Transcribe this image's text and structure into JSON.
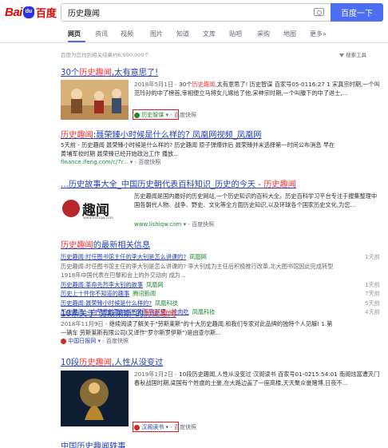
{
  "header": {
    "logo_bai": "Bai",
    "logo_paw": "du",
    "logo_cn": "百度",
    "search_value": "历史趣闻",
    "search_button": "百度一下"
  },
  "tabs": [
    "网页",
    "资讯",
    "视频",
    "图片",
    "知道",
    "文库",
    "贴吧",
    "采购",
    "地图",
    "更多»"
  ],
  "result_count": "百度为您找到相关结果约6,690,000个",
  "tools": "搜索工具",
  "results": {
    "r1": {
      "title_a": "30个",
      "title_em": "历史趣闻",
      "title_b": ",太有意思了!",
      "date": "2018年5月1日 - ",
      "abs_a": "30个",
      "abs_em1": "历史趣闻",
      "abs_b": ",太有意思了! 历史智谋 百家号05-0116:27 1 宋真宗时期,一个叫范玲孙的中了榜首,宰相便立马将女儿嫁给了他,宋神宗时期,一个叫滕下的中了进士,...",
      "source": "历史智谋",
      "snapshot": "百度快照"
    },
    "r2": {
      "title_em": "历史趣闻",
      "title_b": ":聂荣臻小时候是什么样的? 凤凰网视频_凤凰网",
      "abs": "5天前 - 历史趣闻 聂荣臻小时候是什么样的? 历史趣闻 原子弹爆炸后 聂荣臻并未选择第一时间公布消息 早在黄埔军校时期 聂荣臻已经开始政治工作 播放...",
      "url": "finance.ifeng.com/c/7r...",
      "snapshot": "百度快照"
    },
    "r3": {
      "title_a": "...历史故事大全_中国历史朝代表百科知识_历史的今天 - ",
      "title_em": "历史趣闻",
      "abs": "历史趣闻是国内最好的历史网站,一个历史知识的百科大全。历史百科学习平台专注于搜集整理中国各朝代人物、战争、野史、文化等全方面历史知识,以及环球各个国家历史文化,为您...",
      "logo_text": "趣闻",
      "logo_sub": "www.lishiqw.com",
      "url": "www.lishiqw.com",
      "snapshot": "百度快照"
    },
    "news": {
      "title_em": "历史趣闻",
      "title_b": "的最新相关信息",
      "rows": [
        {
          "title": "历史趣闻:时任图书馆主任的李大钊是怎么讲课的?",
          "source": "凤凰网",
          "date": "1天前"
        },
        {
          "title": "历史趣闻:时任图书馆主任的李大钊是怎么讲课的? 李大钊成为主任后积极推行改革,北大图书馆因此完成转型 1918年中国代表在巴黎和会上的外交动向 成为...",
          "source": "",
          "date": ""
        },
        {
          "title": "历史趣闻:革命先烈李大钊的故事",
          "source": "凤凰网",
          "date": "1天前"
        },
        {
          "title": "历史上十件你不知道的趣事",
          "source": "腾讯新闻",
          "date": "7天前"
        },
        {
          "title": "历史趣闻:聂荣臻小时候是什么样的?",
          "source": "凤凰科技",
          "date": "5天前"
        },
        {
          "title": "历史趣闻:一向节俭的影响依旧到陈赓那里一抢肉吃",
          "source": "凤凰科技",
          "date": "4天前"
        }
      ]
    },
    "r5": {
      "title_a": "10条关于\"劳斯莱斯\"的",
      "title_em": "历史趣闻",
      "date": "2018年11月9日 - ",
      "abs": "继续阅读了解关于\"劳斯莱斯\"的十大历史趣闻,和我们专家对此品牌的独特个人见解! 1.第一辆车 劳斯莱斯有限公司(又译作\"罗尔斯罗伊斯\")是由查尔斯...",
      "source": "中国日报网",
      "snapshot": "百度快照"
    },
    "r6": {
      "title_a": "10段",
      "title_em": "历史趣闻",
      "title_b": ",人性从没变过",
      "date": "2019年1月2日 - ",
      "abs": "10段历史趣闻,人性从没变过 汉阁读书 百家号01-0215:54:01 南阁炫富遭灭门 春秋战国时期,梁国有个姓虞的土豪,在大路边盖了一座高楼,天天聚众豪赌博,日夜不...",
      "source": "汉阁读书",
      "snapshot": "百度快照"
    },
    "r7": {
      "title_a": "中国历史趣闻轶事"
    }
  },
  "colors": {
    "link": "#2440b3",
    "highlight": "#f73131",
    "accent": "#4e6ef2",
    "logo_red": "#e10602",
    "source_green": "#1e8b32",
    "annotation_red": "#e51b1b"
  }
}
